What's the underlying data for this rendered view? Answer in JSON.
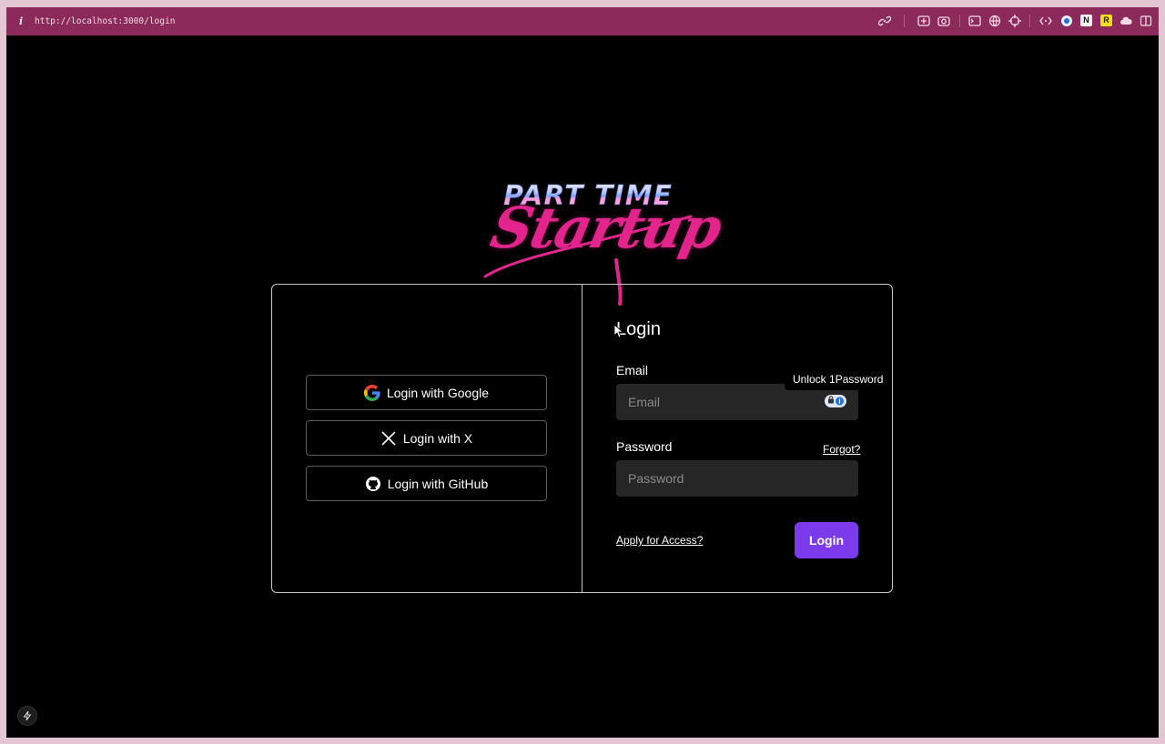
{
  "browser": {
    "url": "http://localhost:3000/login",
    "info_label": "i",
    "toolbar_icons": [
      "link-icon",
      "screenshot-icon",
      "camera-icon",
      "terminal-icon",
      "globe-icon",
      "crosshair-icon",
      "code-icon",
      "extension-globe-icon",
      "notion-icon",
      "extension-r-icon",
      "cloud-icon",
      "sidebar-icon"
    ],
    "ext_labels": {
      "notion": "N",
      "r": "R"
    }
  },
  "logo": {
    "line1": "PART TIME",
    "line2": "Startup"
  },
  "oauth": {
    "google": "Login with Google",
    "x": "Login with X",
    "github": "Login with GitHub"
  },
  "form": {
    "title": "Login",
    "email_label": "Email",
    "email_placeholder": "Email",
    "password_label": "Password",
    "password_placeholder": "Password",
    "forgot": "Forgot?",
    "apply": "Apply for Access?",
    "submit": "Login",
    "password_manager_tooltip": "Unlock 1Password"
  },
  "colors": {
    "toolbar": "#8c2a5b",
    "accent": "#7c3aed",
    "logo_pink": "#e2248c"
  }
}
